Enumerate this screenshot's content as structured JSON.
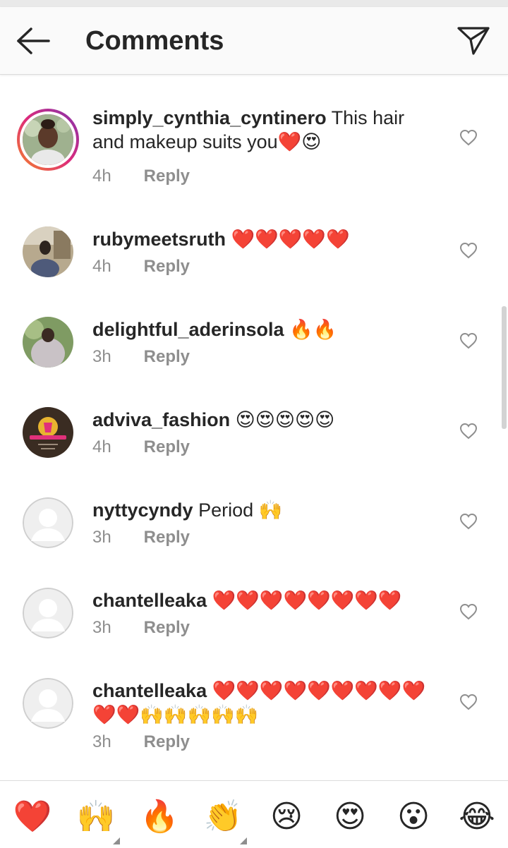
{
  "header": {
    "back_icon": "arrow-left-icon",
    "title": "Comments",
    "share_icon": "send-icon"
  },
  "comments": [
    {
      "username": "simply_cynthia_cyntinero",
      "text": "This hair and makeup suits you❤️😍",
      "time": "4h",
      "reply_label": "Reply",
      "has_story_ring": true
    },
    {
      "username": "rubymeetsruth",
      "text": "❤️❤️❤️❤️❤️",
      "time": "4h",
      "reply_label": "Reply"
    },
    {
      "username": "delightful_aderinsola",
      "text": "🔥🔥",
      "time": "3h",
      "reply_label": "Reply"
    },
    {
      "username": "adviva_fashion",
      "text": "😍😍😍😍😍",
      "time": "4h",
      "reply_label": "Reply"
    },
    {
      "username": "nyttycyndy",
      "text": "Period 🙌",
      "time": "3h",
      "reply_label": "Reply"
    },
    {
      "username": "chantelleaka",
      "text": "❤️❤️❤️❤️❤️❤️❤️❤️",
      "time": "3h",
      "reply_label": "Reply"
    },
    {
      "username": "chantelleaka",
      "text": "❤️❤️❤️❤️❤️❤️❤️❤️❤️❤️❤️🙌🙌🙌🙌🙌",
      "time": "3h",
      "reply_label": "Reply"
    }
  ],
  "quick_reactions": [
    "❤️",
    "🙌",
    "🔥",
    "👏",
    "😢",
    "😍",
    "😮",
    "😂"
  ],
  "colors": {
    "text": "#262626",
    "secondary_text": "#8e8e8e",
    "divider": "#dbdbdb"
  }
}
